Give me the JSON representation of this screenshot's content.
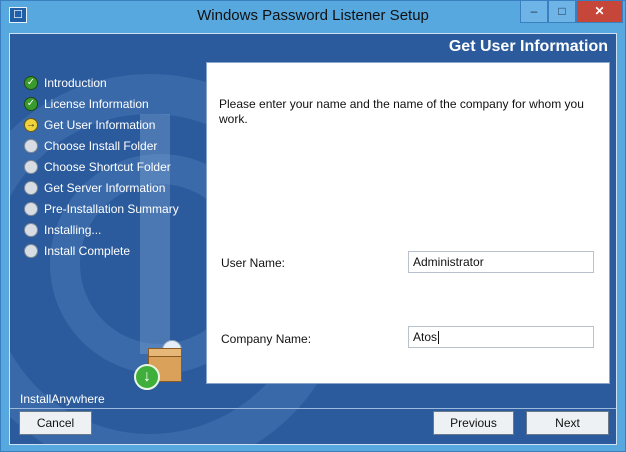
{
  "window": {
    "title": "Windows Password Listener Setup",
    "controls": {
      "minimize": "–",
      "maximize": "□",
      "close": "✕"
    }
  },
  "header": {
    "title": "Get User Information"
  },
  "steps": [
    {
      "label": "Introduction",
      "status": "done"
    },
    {
      "label": "License Information",
      "status": "done"
    },
    {
      "label": "Get User Information",
      "status": "current"
    },
    {
      "label": "Choose Install Folder",
      "status": "pending"
    },
    {
      "label": "Choose Shortcut Folder",
      "status": "pending"
    },
    {
      "label": "Get Server Information",
      "status": "pending"
    },
    {
      "label": "Pre-Installation Summary",
      "status": "pending"
    },
    {
      "label": "Installing...",
      "status": "pending"
    },
    {
      "label": "Install Complete",
      "status": "pending"
    }
  ],
  "form": {
    "instructions": "Please enter your name and the name of the company for whom you work.",
    "user_name_label": "User Name:",
    "user_name_value": "Administrator",
    "company_name_label": "Company Name:",
    "company_name_value": "Atos"
  },
  "footer": {
    "brand": "InstallAnywhere",
    "cancel_label": "Cancel",
    "previous_label": "Previous",
    "next_label": "Next"
  },
  "icons": {
    "done": "check-circle-icon",
    "current": "arrow-circle-icon",
    "pending": "empty-circle-icon"
  },
  "colors": {
    "titlebar": "#58a8e0",
    "background": "#2b5b9c",
    "done": "#3a9b2d",
    "current": "#f0d23a",
    "close": "#c7463a"
  }
}
